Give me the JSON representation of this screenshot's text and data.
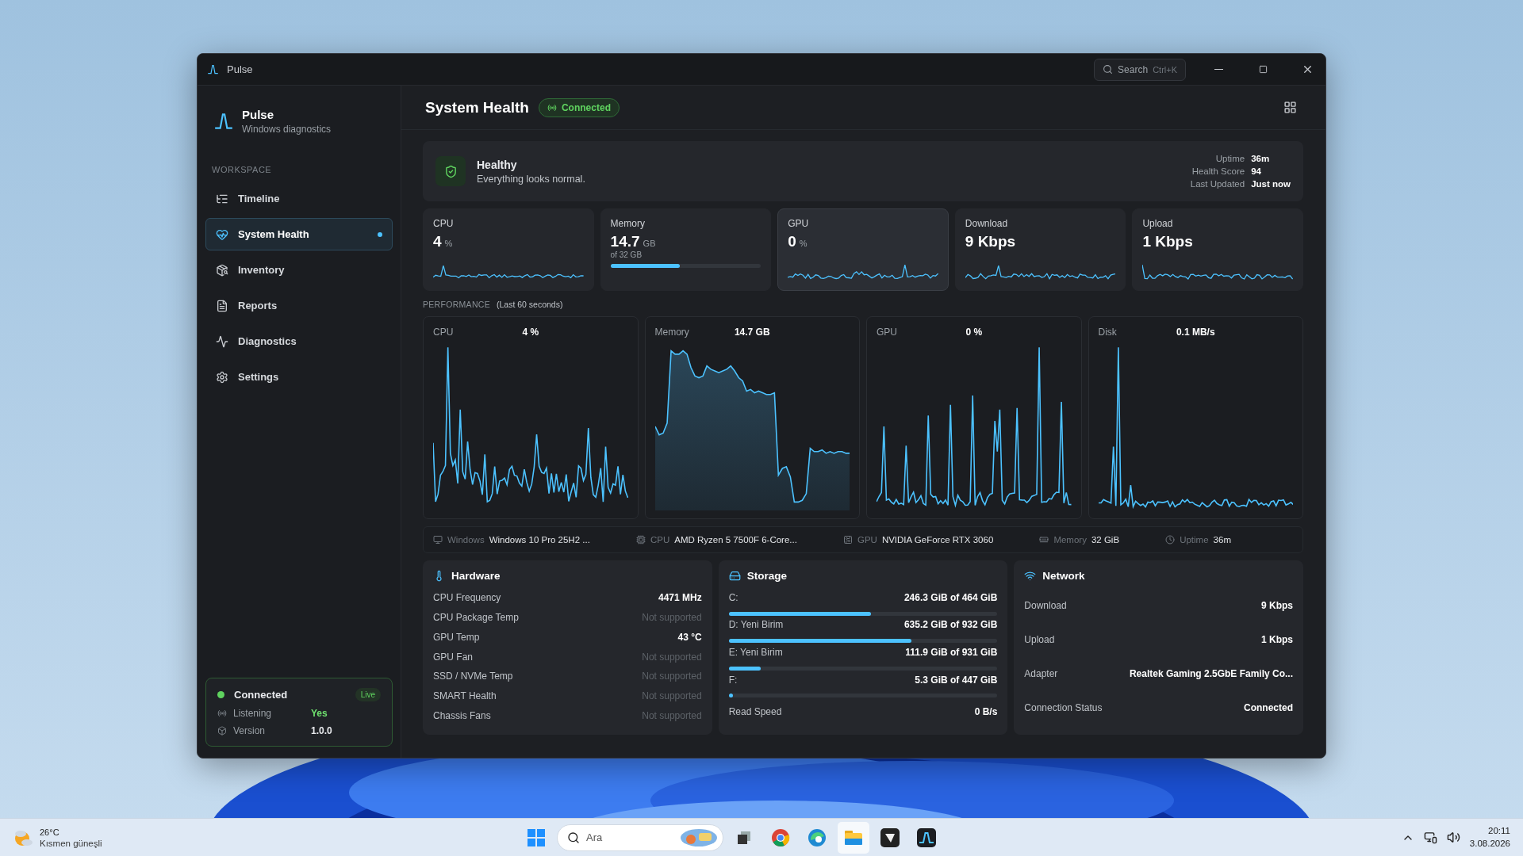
{
  "window": {
    "title": "Pulse",
    "search": {
      "placeholder": "Search",
      "shortcut": "Ctrl+K"
    }
  },
  "sidebar": {
    "app_name": "Pulse",
    "app_subtitle": "Windows diagnostics",
    "section": "WORKSPACE",
    "items": [
      {
        "label": "Timeline",
        "selected": false
      },
      {
        "label": "System Health",
        "selected": true
      },
      {
        "label": "Inventory",
        "selected": false
      },
      {
        "label": "Reports",
        "selected": false
      },
      {
        "label": "Diagnostics",
        "selected": false
      },
      {
        "label": "Settings",
        "selected": false
      }
    ],
    "status": {
      "title": "Connected",
      "badge": "Live",
      "rows": [
        {
          "label": "Listening",
          "value": "Yes",
          "kind": "positive"
        },
        {
          "label": "Version",
          "value": "1.0.0",
          "kind": "plain"
        }
      ]
    }
  },
  "page": {
    "title": "System Health",
    "status_badge": "Connected"
  },
  "health": {
    "title": "Healthy",
    "message": "Everything looks normal.",
    "stats": [
      {
        "label": "Uptime",
        "value": "36m"
      },
      {
        "label": "Health Score",
        "value": "94"
      },
      {
        "label": "Last Updated",
        "value": "Just now"
      }
    ]
  },
  "metric_cards": [
    {
      "label": "CPU",
      "value": "4",
      "unit": "%",
      "selected": false
    },
    {
      "label": "Memory",
      "value": "14.7",
      "unit": "GB",
      "sub": "of 32 GB",
      "level": 0.46,
      "selected": false
    },
    {
      "label": "GPU",
      "value": "0",
      "unit": "%",
      "selected": true
    },
    {
      "label": "Download",
      "value": "9 Kbps",
      "selected": false
    },
    {
      "label": "Upload",
      "value": "1 Kbps",
      "selected": false
    }
  ],
  "performance": {
    "title": "PERFORMANCE",
    "subtitle": "(Last 60 seconds)",
    "charts": [
      {
        "label": "CPU",
        "value": "4 %",
        "kind": "line"
      },
      {
        "label": "Memory",
        "value": "14.7 GB",
        "kind": "area"
      },
      {
        "label": "GPU",
        "value": "0 %",
        "kind": "line"
      },
      {
        "label": "Disk",
        "value": "0.1 MB/s",
        "kind": "line"
      }
    ]
  },
  "system_info": [
    {
      "label": "Windows",
      "value": "Windows 10 Pro 25H2 ..."
    },
    {
      "label": "CPU",
      "value": "AMD Ryzen 5 7500F 6-Core..."
    },
    {
      "label": "GPU",
      "value": "NVIDIA GeForce RTX 3060"
    },
    {
      "label": "Memory",
      "value": "32 GiB"
    },
    {
      "label": "Uptime",
      "value": "36m"
    }
  ],
  "hardware": {
    "title": "Hardware",
    "rows": [
      {
        "label": "CPU Frequency",
        "value": "4471 MHz",
        "disabled": false
      },
      {
        "label": "CPU Package Temp",
        "value": "Not supported",
        "disabled": true
      },
      {
        "label": "GPU Temp",
        "value": "43 °C",
        "disabled": false
      },
      {
        "label": "GPU Fan",
        "value": "Not supported",
        "disabled": true
      },
      {
        "label": "SSD / NVMe Temp",
        "value": "Not supported",
        "disabled": true
      },
      {
        "label": "SMART Health",
        "value": "Not supported",
        "disabled": true
      },
      {
        "label": "Chassis Fans",
        "value": "Not supported",
        "disabled": true
      }
    ]
  },
  "storage": {
    "title": "Storage",
    "drives": [
      {
        "label": "C:",
        "value": "246.3 GiB of 464 GiB",
        "level": 0.53
      },
      {
        "label": "D: Yeni Birim",
        "value": "635.2 GiB of 932 GiB",
        "level": 0.68
      },
      {
        "label": "E: Yeni Birim",
        "value": "111.9 GiB of 931 GiB",
        "level": 0.12
      },
      {
        "label": "F:",
        "value": "5.3 GiB of 447 GiB",
        "level": 0.012
      }
    ],
    "read_speed": {
      "label": "Read Speed",
      "value": "0 B/s"
    }
  },
  "network": {
    "title": "Network",
    "rows": [
      {
        "label": "Download",
        "value": "9 Kbps"
      },
      {
        "label": "Upload",
        "value": "1 Kbps"
      },
      {
        "label": "Adapter",
        "value": "Realtek Gaming 2.5GbE Family Co..."
      },
      {
        "label": "Connection Status",
        "value": "Connected"
      }
    ]
  },
  "taskbar": {
    "weather": {
      "temp": "26°C",
      "desc": "Kısmen güneşli"
    },
    "search": {
      "placeholder": "Ara"
    },
    "time": "20:11",
    "date": "3.08.2026"
  }
}
